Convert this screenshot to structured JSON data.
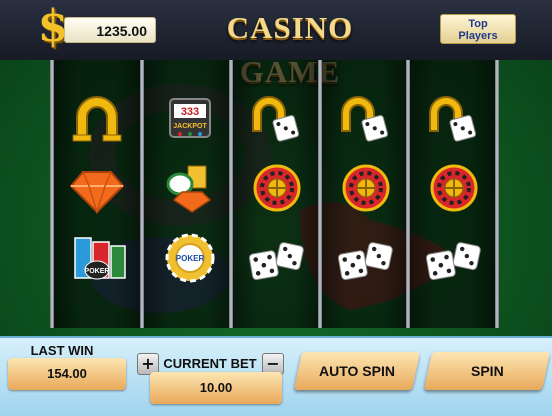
{
  "header": {
    "currency_symbol": "$",
    "balance": "1235.00",
    "title": "CASINO GAME",
    "top_players": "Top Players"
  },
  "reels": [
    [
      "horseshoe-icon",
      "diamond-icon",
      "chips-stack-icon"
    ],
    [
      "jackpot-machine-icon",
      "chips-diamond-icon",
      "poker-chip-icon"
    ],
    [
      "horseshoe-dice-icon",
      "roulette-icon",
      "dice-icon"
    ],
    [
      "horseshoe-dice-icon",
      "roulette-icon",
      "dice-icon"
    ],
    [
      "horseshoe-dice-icon",
      "roulette-icon",
      "dice-icon"
    ]
  ],
  "symbol_text": {
    "jackpot_digits": "333",
    "jackpot_label": "JACKPOT",
    "poker_chip_label": "POKER",
    "chips_stack_label": "POKER"
  },
  "footer": {
    "last_win_label": "LAST WIN",
    "last_win_value": "154.00",
    "plus": "+",
    "minus": "−",
    "current_bet_label": "CURRENT BET",
    "current_bet_value": "10.00",
    "auto_spin": "AUTO SPIN",
    "spin": "SPIN"
  },
  "colors": {
    "felt": "#0f5a22",
    "gold": "#f3c22a",
    "button": "#e8a95a",
    "footer": "#9fd3ee"
  }
}
